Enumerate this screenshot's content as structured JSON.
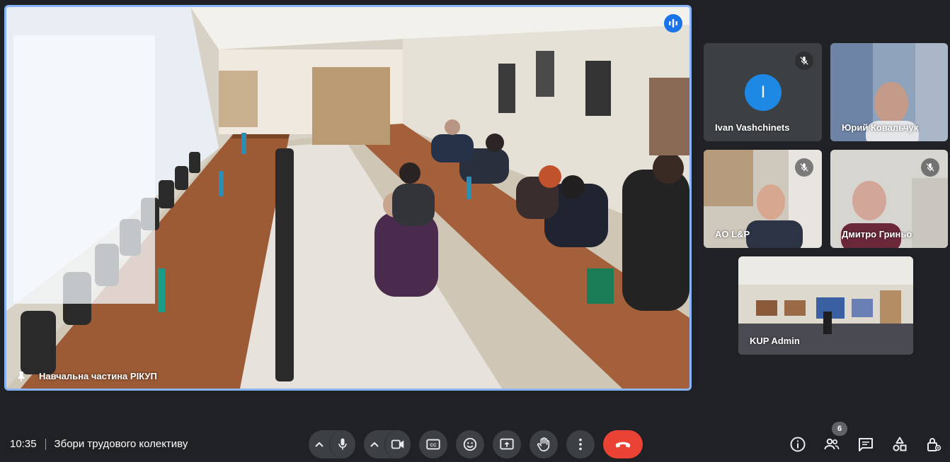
{
  "meeting": {
    "time": "10:35",
    "title": "Збори трудового колективу"
  },
  "main_tile": {
    "name": "Навчальна частина РІКУП"
  },
  "participants": [
    {
      "name": "Ivan Vashchinets",
      "avatar_letter": "I",
      "muted": true
    },
    {
      "name": "Юрий Ковальчук",
      "muted": false
    },
    {
      "name": "AO L&P",
      "muted": true
    },
    {
      "name": "Дмитро Гриньо",
      "muted": true
    },
    {
      "name": "KUP Admin",
      "muted": false
    }
  ],
  "people_count": "6",
  "colors": {
    "background": "#202124",
    "active_border": "#8ab4f8",
    "hangup": "#ea4335",
    "avatar": "#1e88e5"
  },
  "icons": {
    "controls": [
      "mic-icon",
      "camera-icon",
      "captions-icon",
      "emoji-icon",
      "present-icon",
      "raise-hand-icon",
      "more-options-icon",
      "hang-up-icon"
    ],
    "right": [
      "info-icon",
      "people-icon",
      "chat-icon",
      "activities-icon",
      "host-controls-icon"
    ]
  }
}
